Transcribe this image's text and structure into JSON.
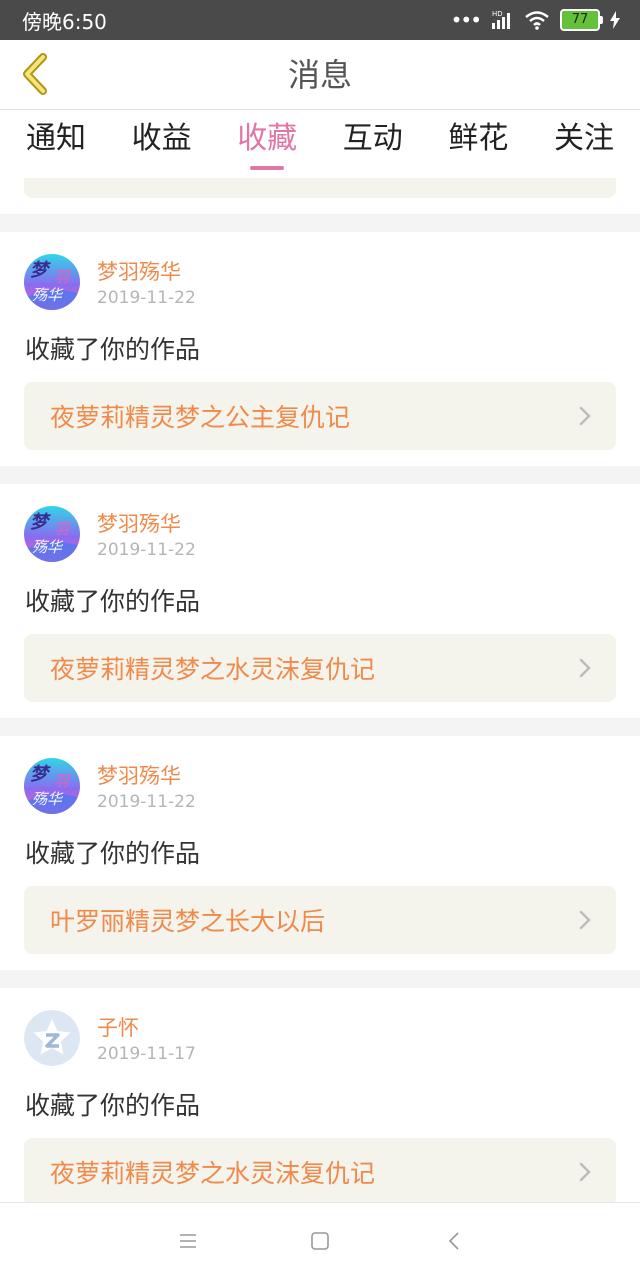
{
  "status_bar": {
    "time": "傍晚6:50",
    "network_label": "HD",
    "battery": "77"
  },
  "header": {
    "title": "消息"
  },
  "tabs": [
    {
      "label": "通知",
      "active": false
    },
    {
      "label": "收益",
      "active": false
    },
    {
      "label": "收藏",
      "active": true
    },
    {
      "label": "互动",
      "active": false
    },
    {
      "label": "鲜花",
      "active": false
    },
    {
      "label": "关注",
      "active": false
    }
  ],
  "items": [
    {
      "user": "梦羽殇华",
      "date": "2019-11-22",
      "action": "收藏了你的作品",
      "work": "夜萝莉精灵梦之公主复仇记",
      "avatar": "anime-avatar"
    },
    {
      "user": "梦羽殇华",
      "date": "2019-11-22",
      "action": "收藏了你的作品",
      "work": "夜萝莉精灵梦之水灵沫复仇记",
      "avatar": "anime-avatar"
    },
    {
      "user": "梦羽殇华",
      "date": "2019-11-22",
      "action": "收藏了你的作品",
      "work": "叶罗丽精灵梦之长大以后",
      "avatar": "anime-avatar"
    },
    {
      "user": "子怀",
      "date": "2019-11-17",
      "action": "收藏了你的作品",
      "work": "夜萝莉精灵梦之水灵沫复仇记",
      "avatar": "default-avatar"
    }
  ],
  "avatar_text": {
    "line1": "梦",
    "line2": "羽",
    "line3": "殇华"
  },
  "colors": {
    "accent": "#e277a6",
    "link": "#f08a4b",
    "header_bg": "#4a4a4a",
    "card_link_bg": "#f4f4ec"
  }
}
